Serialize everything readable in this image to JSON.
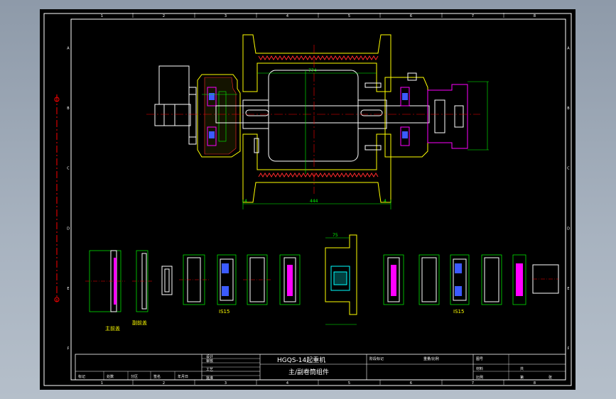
{
  "colors": {
    "background": "#000000",
    "frame": "#ffffff",
    "shaft": "#ffff00",
    "housing": "#ff2a2a",
    "dimension": "#00ff00",
    "bearing": "#ff00ff",
    "seal": "#3b5bff",
    "centerline": "#ff0000",
    "hub": "#00ffff"
  },
  "zone_columns": [
    "1",
    "2",
    "3",
    "4",
    "5",
    "6",
    "7",
    "8"
  ],
  "zone_rows": [
    "A",
    "B",
    "C",
    "D",
    "E",
    "F"
  ],
  "dimensions": {
    "drum_width": "774",
    "drum_length": "444",
    "left_flange": "4",
    "right_flange": "4",
    "hub_dim": "75"
  },
  "part_labels": {
    "main_cover": "主前盖",
    "aux_cover": "副前盖",
    "seal_left": "IS15",
    "seal_right": "IS15"
  },
  "title_block": {
    "model": "HGQS-14起重机",
    "drawing_name": "主/副卷筒组件",
    "design": "设计",
    "check": "审核",
    "process": "工艺",
    "approve": "批准",
    "mark": "标记",
    "count": "处数",
    "division": "分区",
    "change_doc": "更改文件号",
    "sign": "签名",
    "date": "年月日",
    "stage_mark": "阶段标记",
    "weight_scale": "重量/比例",
    "sheet_total": "共",
    "sheet": "张",
    "sheet_no": "第",
    "unit_label": "图号",
    "material": "材料",
    "scale_label": "比例"
  }
}
